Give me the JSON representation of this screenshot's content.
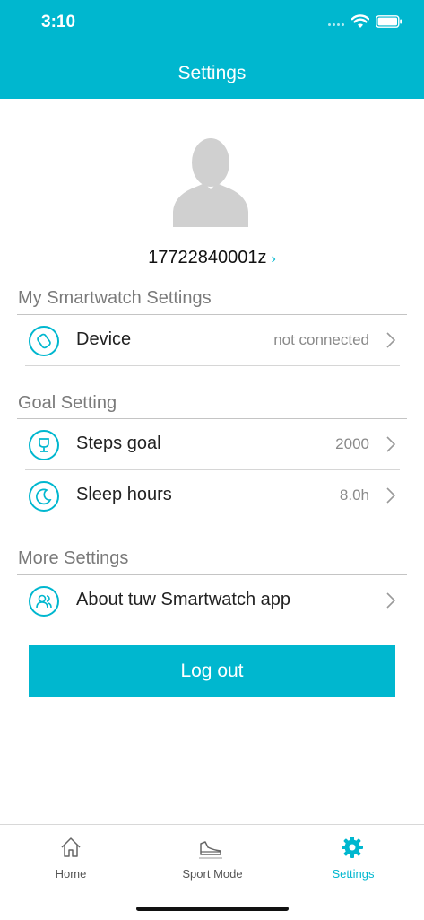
{
  "status_bar": {
    "time": "3:10"
  },
  "header": {
    "title": "Settings"
  },
  "profile": {
    "account": "17722840001z",
    "chevron": "›"
  },
  "sections": [
    {
      "title": "My Smartwatch Settings"
    },
    {
      "title": "Goal Setting"
    },
    {
      "title": "More Settings"
    }
  ],
  "rows": {
    "device": {
      "label": "Device",
      "value": "not connected",
      "icon": "watch-icon"
    },
    "steps": {
      "label": "Steps goal",
      "value": "2000",
      "icon": "trophy-icon"
    },
    "sleep": {
      "label": "Sleep hours",
      "value": "8.0h",
      "icon": "moon-icon"
    },
    "about": {
      "label": "About tuw Smartwatch app",
      "value": "",
      "icon": "users-icon"
    }
  },
  "logout_label": "Log out",
  "tabs": [
    {
      "label": "Home",
      "icon": "home-icon",
      "active": false
    },
    {
      "label": "Sport Mode",
      "icon": "shoe-icon",
      "active": false
    },
    {
      "label": "Settings",
      "icon": "gear-icon",
      "active": true
    }
  ],
  "colors": {
    "accent": "#00b7cf",
    "background": "#ffffff",
    "muted_text": "#7a7a7a"
  }
}
